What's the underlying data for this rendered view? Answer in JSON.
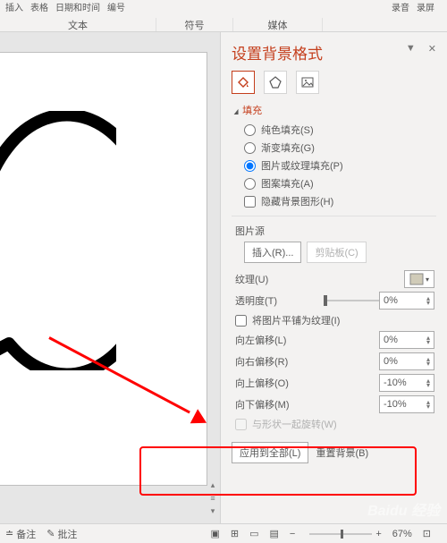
{
  "ribbon": {
    "top_items": [
      "插入",
      "表格",
      "日期和时间",
      "编号"
    ],
    "right_items": [
      "录音",
      "录屏"
    ],
    "groups": {
      "text": "文本",
      "symbols": "符号",
      "media": "媒体"
    }
  },
  "pane": {
    "title": "设置背景格式",
    "section_fill": "填充",
    "fill_solid": "纯色填充(S)",
    "fill_gradient": "渐变填充(G)",
    "fill_picture": "图片或纹理填充(P)",
    "fill_pattern": "图案填充(A)",
    "hide_bg": "隐藏背景图形(H)",
    "pic_source": "图片源",
    "insert_btn": "插入(R)...",
    "clipboard_btn": "剪贴板(C)",
    "texture": "纹理(U)",
    "transparency": "透明度(T)",
    "trans_val": "0%",
    "tile": "将图片平铺为纹理(I)",
    "off_left": "向左偏移(L)",
    "off_left_v": "0%",
    "off_right": "向右偏移(R)",
    "off_right_v": "0%",
    "off_up": "向上偏移(O)",
    "off_up_v": "-10%",
    "off_down": "向下偏移(M)",
    "off_down_v": "-10%",
    "rotate_with": "与形状一起旋转(W)",
    "apply_all": "应用到全部(L)",
    "reset_bg": "重置背景(B)"
  },
  "status": {
    "notes": "备注",
    "comments": "批注",
    "zoom": "67%"
  },
  "watermark": "Baidu 经验"
}
